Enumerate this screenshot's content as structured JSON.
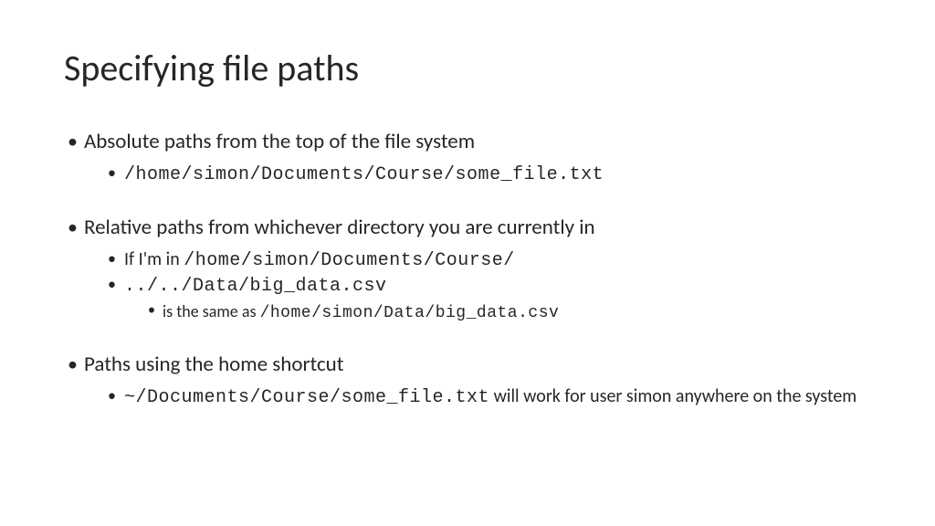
{
  "title": "Specifying file paths",
  "bullets": {
    "b1": {
      "heading": "Absolute paths from the top of the file system",
      "sub1_code": "/home/simon/Documents/Course/some_file.txt"
    },
    "b2": {
      "heading": "Relative paths from whichever directory you are currently in",
      "sub1_prefix": "If I'm in ",
      "sub1_code": "/home/simon/Documents/Course/",
      "sub2_code": "../../Data/big_data.csv",
      "sub2_note_prefix": "is the same as ",
      "sub2_note_code": "/home/simon/Data/big_data.csv"
    },
    "b3": {
      "heading": "Paths using the home shortcut",
      "sub1_code": "~/Documents/Course/some_file.txt",
      "sub1_suffix": "  will work for user simon anywhere on the system"
    }
  }
}
